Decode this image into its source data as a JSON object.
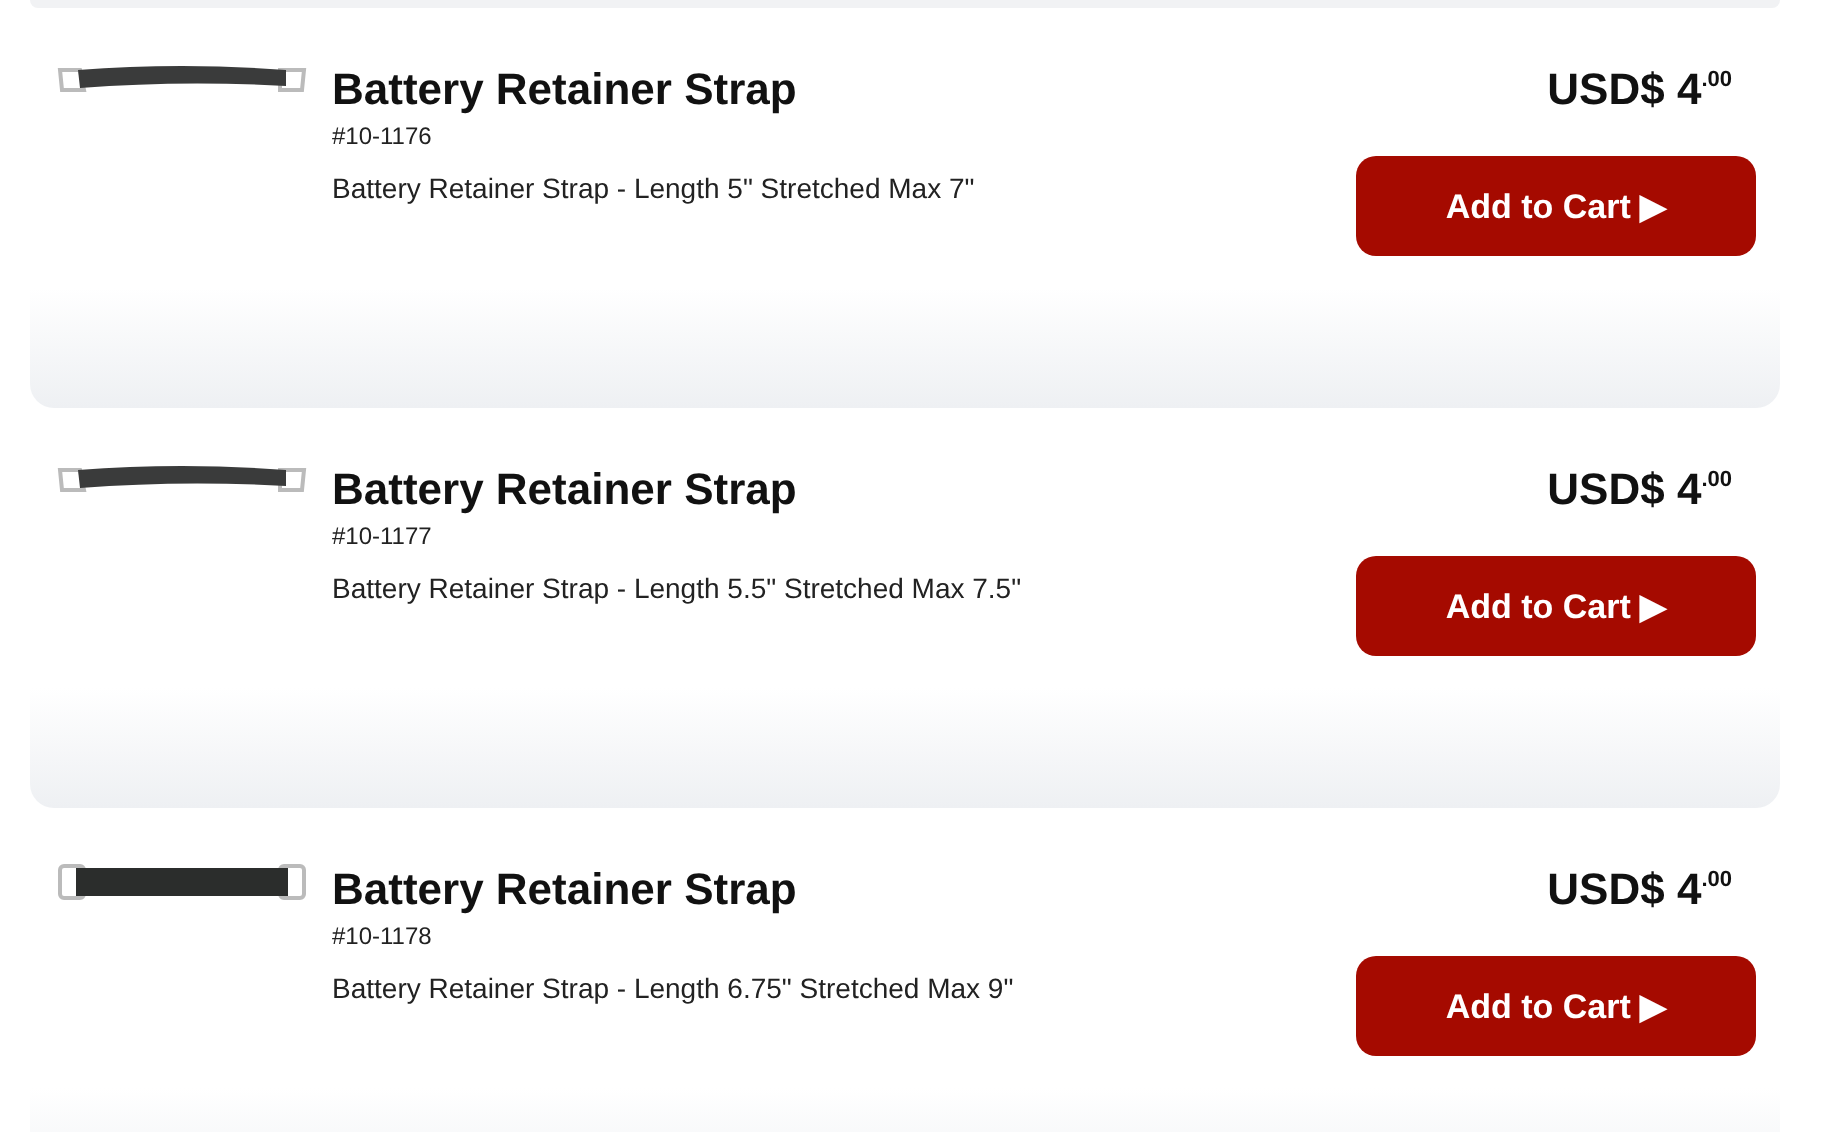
{
  "products": [
    {
      "title": "Battery Retainer Strap",
      "sku": "#10-1176",
      "description": "Battery Retainer Strap - Length 5\" Stretched Max 7\"",
      "price": "USD$ 4$^{.00}$",
      "button": "Add to Cart ▶"
    },
    {
      "title": "Battery Retainer Strap",
      "sku": "#10-1177",
      "description": "Battery Retainer Strap - Length 5.5\" Stretched Max 7.5\"",
      "price": "USD$ 4$^{.00}$",
      "button": "Add to Cart ▶"
    },
    {
      "title": "Battery Retainer Strap",
      "sku": "#10-1178",
      "description": "Battery Retainer Strap - Length 6.75\" Stretched Max 9\"",
      "price": "USD$ 4$^{.00}$",
      "button": "Add to Cart ▶"
    }
  ]
}
